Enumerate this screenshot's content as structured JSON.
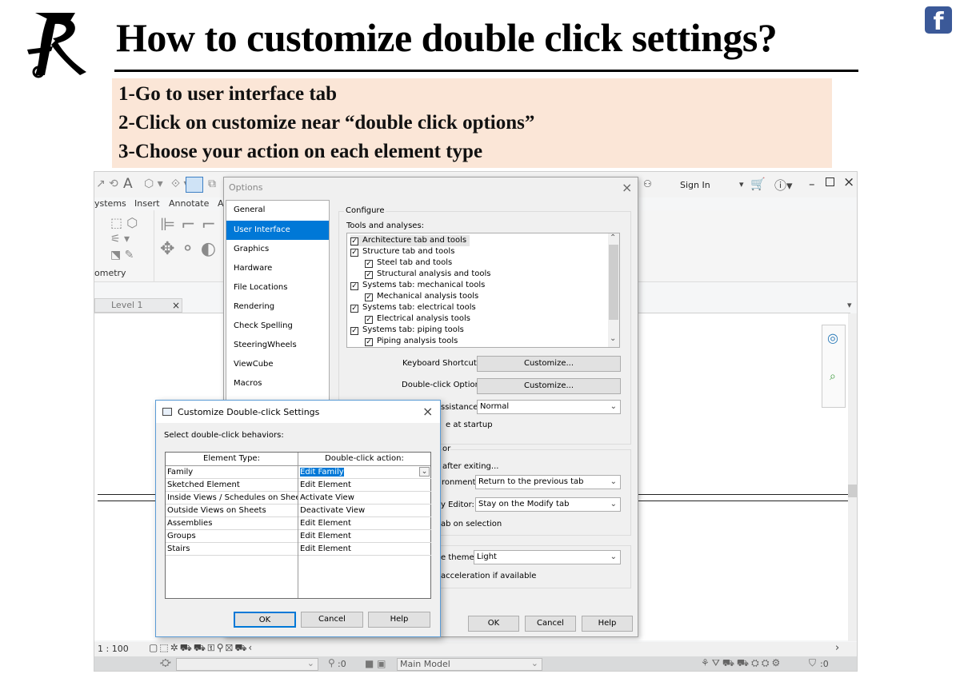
{
  "slide": {
    "title": "How to customize double click settings?",
    "steps": [
      "1-Go to user interface tab",
      "2-Click on customize near “double click options”",
      "3-Choose your action on each element type"
    ],
    "social_icon": "facebook-icon",
    "logo_letter": "R"
  },
  "revit": {
    "ribbon_tabs": [
      "ystems",
      "Insert",
      "Annotate",
      "A"
    ],
    "ribbon_panel_label": "ometry",
    "sign_in": "Sign In",
    "view_tab": "Level 1",
    "scale": "1 : 100",
    "model_dropdown": "Main Model",
    "zero_a": ":0",
    "zero_b": ":0"
  },
  "options": {
    "title": "Options",
    "nav": [
      {
        "label": "General"
      },
      {
        "label": "User Interface",
        "selected": true
      },
      {
        "label": "Graphics"
      },
      {
        "label": "Hardware"
      },
      {
        "label": "File Locations"
      },
      {
        "label": "Rendering"
      },
      {
        "label": "Check Spelling"
      },
      {
        "label": "SteeringWheels"
      },
      {
        "label": "ViewCube"
      },
      {
        "label": "Macros"
      }
    ],
    "configure_label": "Configure",
    "tools_label": "Tools and analyses:",
    "tools": [
      {
        "label": "Architecture tab and tools",
        "level": 0,
        "checked": true
      },
      {
        "label": "Structure tab and tools",
        "level": 0,
        "checked": true
      },
      {
        "label": "Steel tab and tools",
        "level": 1,
        "checked": true
      },
      {
        "label": "Structural analysis and tools",
        "level": 1,
        "checked": true
      },
      {
        "label": "Systems tab: mechanical tools",
        "level": 0,
        "checked": true
      },
      {
        "label": "Mechanical analysis tools",
        "level": 1,
        "checked": true
      },
      {
        "label": "Systems tab: electrical tools",
        "level": 0,
        "checked": true
      },
      {
        "label": "Electrical analysis tools",
        "level": 1,
        "checked": true
      },
      {
        "label": "Systems tab: piping tools",
        "level": 0,
        "checked": true
      },
      {
        "label": "Piping analysis tools",
        "level": 1,
        "checked": true
      }
    ],
    "keyboard_label": "Keyboard Shortcuts:",
    "keyboard_btn": "Customize...",
    "doubleclick_label": "Double-click Options:",
    "doubleclick_btn": "Customize...",
    "assistance_label": "ssistance:",
    "assistance_value": "Normal",
    "startup_text": "e at startup",
    "or_text": "or",
    "after_exiting": "after exiting...",
    "ronment_label": "ronment:",
    "ronment_value": "Return to the previous tab",
    "editor_label": "y Editor:",
    "editor_value": "Stay on the Modify tab",
    "tab_on_selection": "ab on selection",
    "theme_label": "e theme:",
    "theme_value": "Light",
    "accel_text": "acceleration if available",
    "ok": "OK",
    "cancel": "Cancel",
    "help": "Help"
  },
  "customize_dc": {
    "title": "Customize Double-click Settings",
    "instruction": "Select double-click behaviors:",
    "col_element": "Element Type:",
    "col_action": "Double-click action:",
    "rows": [
      {
        "element": "Family",
        "action": "Edit Family",
        "selected": true
      },
      {
        "element": "Sketched Element",
        "action": "Edit Element"
      },
      {
        "element": "Inside Views / Schedules on Sheets",
        "action": "Activate View"
      },
      {
        "element": "Outside Views on Sheets",
        "action": "Deactivate View"
      },
      {
        "element": "Assemblies",
        "action": "Edit Element"
      },
      {
        "element": "Groups",
        "action": "Edit Element"
      },
      {
        "element": "Stairs",
        "action": "Edit Element"
      }
    ],
    "ok": "OK",
    "cancel": "Cancel",
    "help": "Help"
  }
}
